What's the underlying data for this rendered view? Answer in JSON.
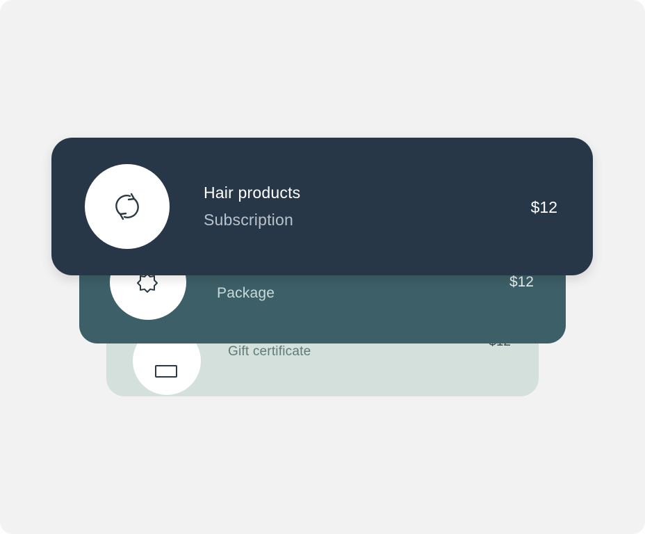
{
  "items": [
    {
      "title": "Hair products",
      "subtitle": "Subscription",
      "price": "$12",
      "icon": "refresh-icon",
      "background": "#283747"
    },
    {
      "subtitle": "Package",
      "price": "$12",
      "icon": "badge-icon",
      "background": "#3d5f67"
    },
    {
      "subtitle": "Gift certificate",
      "price": "$12",
      "icon": "gift-card-icon",
      "background": "#d3e0dc"
    }
  ],
  "colors": {
    "page_background": "#f2f2f2",
    "avatar_background": "#ffffff"
  }
}
